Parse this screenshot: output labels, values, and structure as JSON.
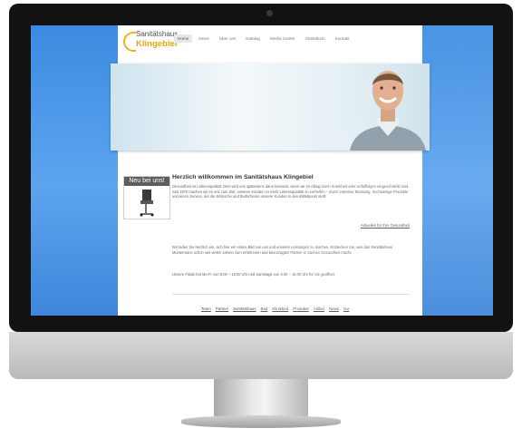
{
  "site": {
    "logo_line1": "Sanitätshaus",
    "logo_line2": "Klingebiel",
    "nav": [
      "Home",
      "News",
      "Über uns",
      "Katalog",
      "Media Center",
      "Gästebuch",
      "Kontakt"
    ],
    "active_nav": "Home",
    "sidebar_heading": "Neu bei uns!",
    "heading": "Herzlich willkommen im Sanitätshaus Klingebiel",
    "intro": "Gesundheit ist Lebensqualität. Dies wird uns spätestens dann bewusst, wenn wir im Alltag durch Krankheit oder Unfallfolgen eingeschränkt sind. Seit 1970 machen wir es uns zum Ziel, unseren Kunden zu mehr Lebensqualität zu verhelfen – durch intensive Beratung, hochwertige Produkte und einen Service, der die Wünsche und Bedürfnisse unserer Kunden in den Mittelpunkt stellt.",
    "news_link": "Aktuelles für Ihre Gesundheit",
    "paragraph2": "Wir laden Sie herzlich ein, sich hier ein erstes Bild von uns und unseren Leistungen zu machen. Entdecken Sie, was das Sanitätshaus Mustermann schon seit vielen Jahren zum erfahrenen und bevorzugten Partner in Sachen Gesundheit macht.",
    "hours": "Unsere Filiale hat Mo-Fr von 8.00 – 18.00 Uhr und Samstags von 8.00 – 16.00 Uhr für Sie geöffnet.",
    "footer_links": [
      "Team",
      "Partner",
      "Sanitätshaus",
      "Bad",
      "Klinikbed",
      "Produkte",
      "Artikel",
      "News",
      "nur"
    ]
  },
  "colors": {
    "screen_blue": "#4a96e8",
    "logo_orange": "#e8a615",
    "bezel": "#121212"
  },
  "icons": {
    "camera": "webcam-dot",
    "product": "wheelchair-product-image",
    "hero": "smiling-man-photo"
  }
}
